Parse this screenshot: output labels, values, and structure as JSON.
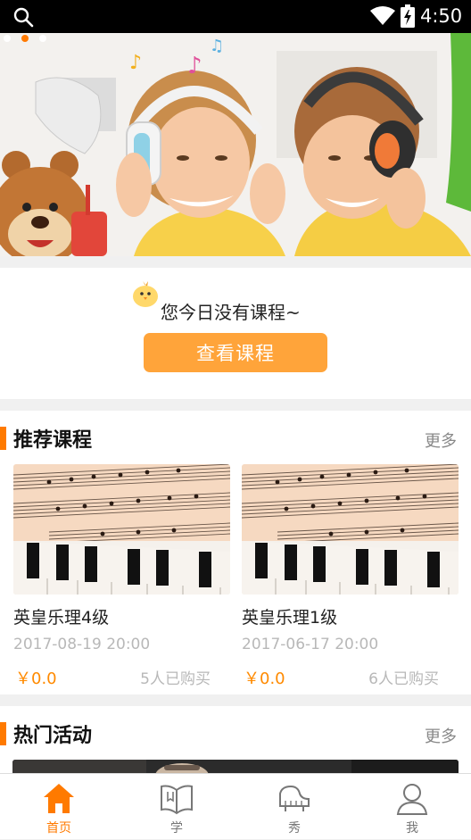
{
  "status_bar": {
    "time": "4:50"
  },
  "today": {
    "message": "您今日没有课程~",
    "button": "查看课程"
  },
  "recommended": {
    "title": "推荐课程",
    "more": "更多",
    "courses": [
      {
        "name": "英皇乐理4级",
        "datetime": "2017-08-19 20:00",
        "price": "￥0.0",
        "buyers": "5人已购买"
      },
      {
        "name": "英皇乐理1级",
        "datetime": "2017-06-17 20:00",
        "price": "￥0.0",
        "buyers": "6人已购买"
      }
    ]
  },
  "activities": {
    "title": "热门活动",
    "more": "更多"
  },
  "bottom_nav": [
    {
      "label": "首页",
      "icon": "home-icon",
      "active": true
    },
    {
      "label": "学",
      "icon": "book-icon",
      "active": false
    },
    {
      "label": "秀",
      "icon": "piano-icon",
      "active": false
    },
    {
      "label": "我",
      "icon": "user-icon",
      "active": false
    }
  ],
  "colors": {
    "accent": "#ff7a00",
    "button": "#ffa43a",
    "status_bar": "#000000"
  },
  "banner": {
    "slide_count": 3,
    "active_slide": 2
  }
}
